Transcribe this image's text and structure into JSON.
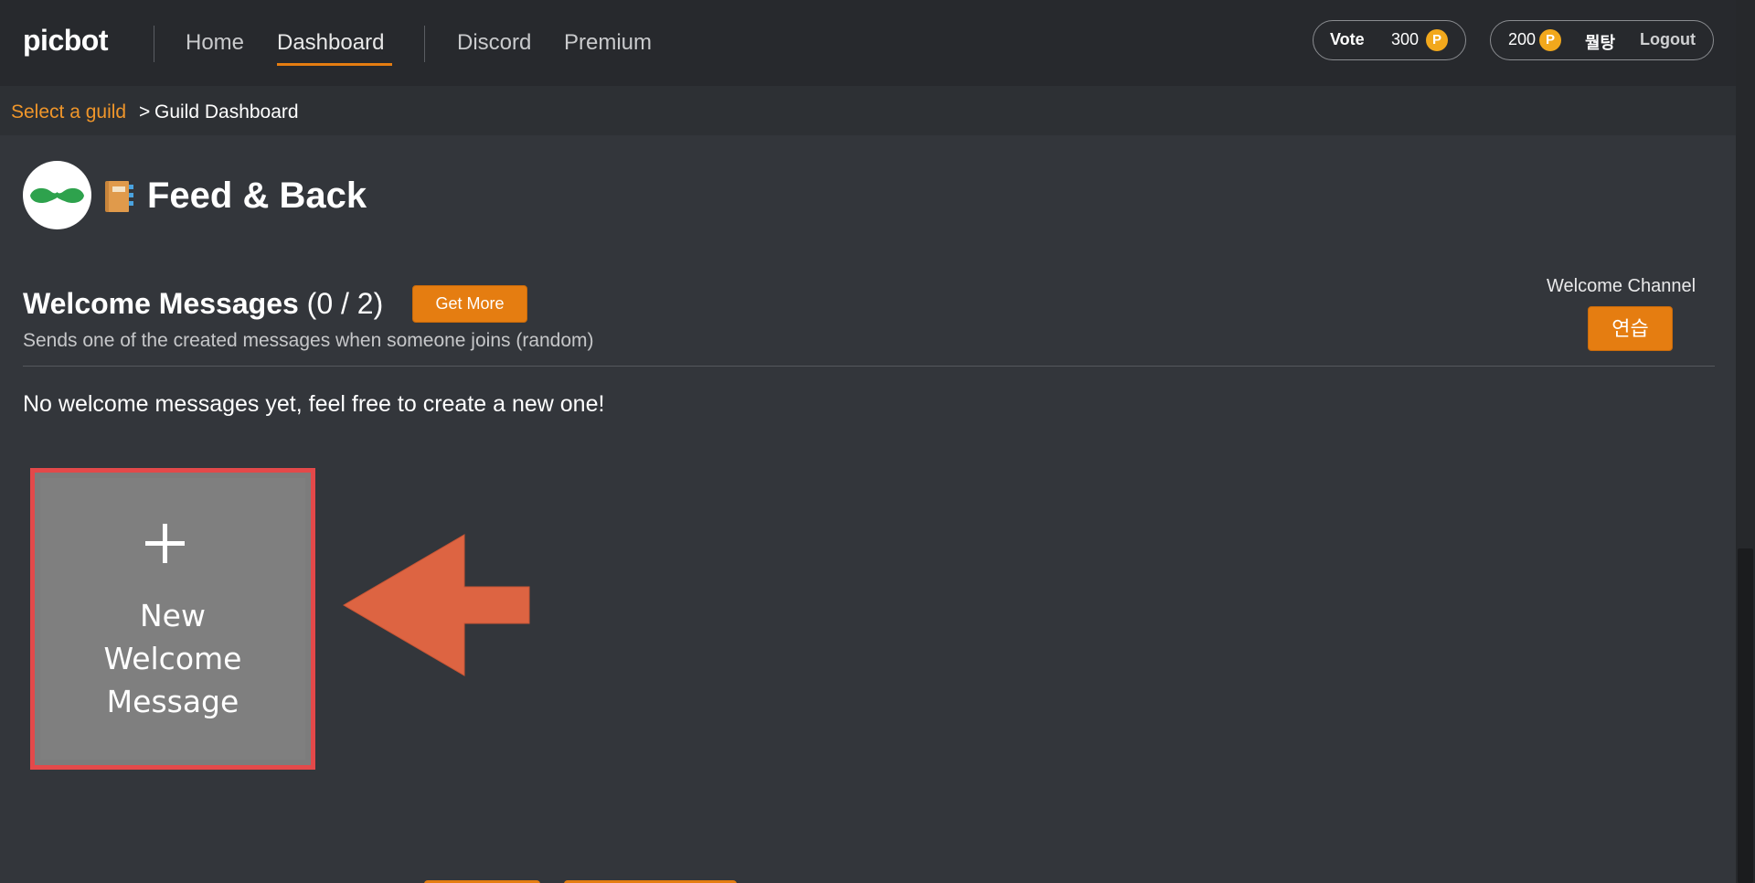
{
  "nav": {
    "logo": "picbot",
    "links": [
      "Home",
      "Dashboard",
      "Discord",
      "Premium"
    ],
    "active": "Dashboard"
  },
  "vote": {
    "label": "Vote",
    "points": "300",
    "coin_symbol": "P"
  },
  "account": {
    "points": "200",
    "coin_symbol": "P",
    "username": "뭘탕",
    "logout_label": "Logout"
  },
  "breadcrumb": {
    "parent": "Select a guild",
    "separator": ">",
    "current": "Guild Dashboard"
  },
  "guild": {
    "name": "Feed & Back",
    "avatar_icon": "mustache-icon",
    "title_icon": "notebook-icon"
  },
  "welcome": {
    "title": "Welcome Messages",
    "count": "(0 / 2)",
    "get_more_label": "Get More",
    "subtitle": "Sends one of the created messages when someone joins (random)",
    "channel_label": "Welcome Channel",
    "channel_value": "연습",
    "empty_message": "No welcome messages yet, feel free to create a new one!",
    "new_card": {
      "plus": "+",
      "label": "New\nWelcome\nMessage"
    }
  },
  "colors": {
    "accent": "#e57d11",
    "highlight_border": "#e3494a",
    "arrow": "#dd6442",
    "background": "#33363b",
    "nav_background": "#27292d"
  }
}
